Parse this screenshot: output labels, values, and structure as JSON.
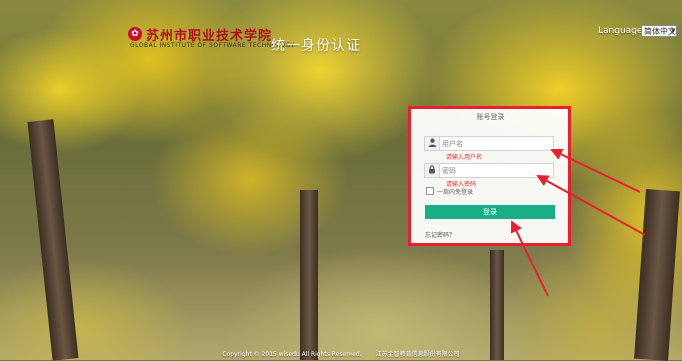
{
  "header": {
    "logo_cn": "苏州市职业技术学院",
    "logo_en": "GLOBAL INSTITUTE OF SOFTWARE TECHNOLOGY",
    "site_title": "统一身份认证",
    "language_label": "Language:",
    "language_selected": "简体中文"
  },
  "login": {
    "title": "账号登录",
    "username_placeholder": "用户名",
    "username_error": "请输入用户名",
    "password_placeholder": "密码",
    "password_error": "请输入密码",
    "remember_label": "一周内免登录",
    "submit_label": "登录",
    "forgot_label": "忘记密码？"
  },
  "footer": {
    "copyright": "Copyright © 2015 wisedu All Rights Reserved.",
    "company": "江苏金智教育信息股份有限公司"
  },
  "icons": {
    "user": "user-icon",
    "lock": "lock-icon"
  },
  "colors": {
    "highlight": "#e8212e",
    "button": "#1aae86",
    "error": "#e0352f",
    "logo": "#b0101e"
  }
}
